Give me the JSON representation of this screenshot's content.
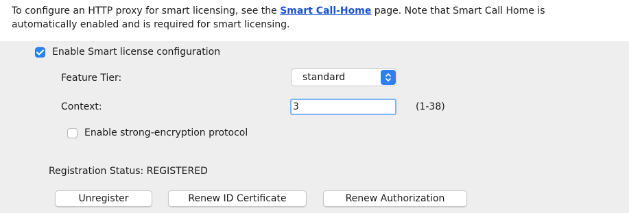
{
  "intro": {
    "text_before_link": "To configure an HTTP proxy for smart licensing, see the ",
    "link_label": "Smart Call-Home",
    "text_after_link": " page. Note that Smart Call Home is",
    "line2": "automatically enabled and is required for smart licensing."
  },
  "enable_smart": {
    "label": "Enable Smart license configuration",
    "checked": true
  },
  "feature_tier": {
    "label": "Feature Tier:",
    "value": "standard"
  },
  "context": {
    "label": "Context:",
    "value": "3",
    "range": "(1-38)"
  },
  "strong_encryption": {
    "label": "Enable strong-encryption protocol",
    "checked": false
  },
  "registration": {
    "label": "Registration Status:",
    "value": "REGISTERED"
  },
  "buttons": {
    "unregister": "Unregister",
    "renew_id": "Renew ID Certificate",
    "renew_auth": "Renew Authorization"
  },
  "colors": {
    "accent": "#2f80ed",
    "link": "#1a4fd6",
    "panel": "#eeeeee"
  },
  "icons": {
    "checkmark": "checkmark-icon",
    "select_arrows": "updown-chevron-icon"
  }
}
